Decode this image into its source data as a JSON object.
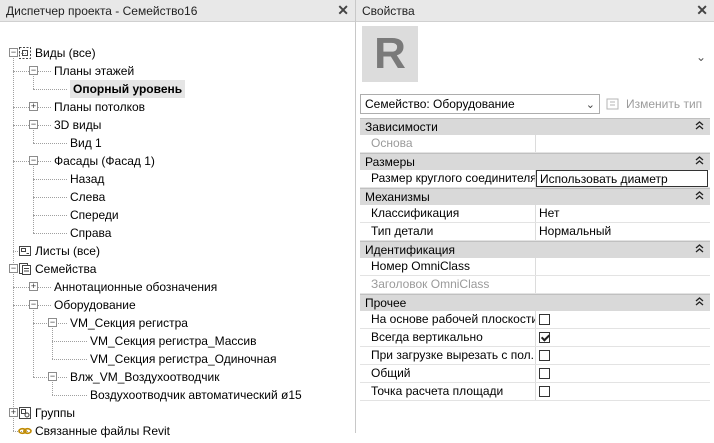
{
  "project_browser": {
    "title": "Диспетчер проекта - Семейство16",
    "nodes": [
      {
        "label": "Виды (все)",
        "level": 0,
        "exp": "-",
        "icon": "views"
      },
      {
        "label": "Планы этажей",
        "level": 1,
        "exp": "-"
      },
      {
        "label": "Опорный уровень",
        "level": 2,
        "selected": true
      },
      {
        "label": "Планы потолков",
        "level": 1,
        "exp": "+"
      },
      {
        "label": "3D виды",
        "level": 1,
        "exp": "-"
      },
      {
        "label": "Вид 1",
        "level": 2
      },
      {
        "label": "Фасады (Фасад 1)",
        "level": 1,
        "exp": "-"
      },
      {
        "label": "Назад",
        "level": 2
      },
      {
        "label": "Слева",
        "level": 2
      },
      {
        "label": "Спереди",
        "level": 2
      },
      {
        "label": "Справа",
        "level": 2
      },
      {
        "label": "Листы (все)",
        "level": 0,
        "icon": "sheets"
      },
      {
        "label": "Семейства",
        "level": 0,
        "exp": "-",
        "icon": "families"
      },
      {
        "label": "Аннотационные обозначения",
        "level": 1,
        "exp": "+"
      },
      {
        "label": "Оборудование",
        "level": 1,
        "exp": "-"
      },
      {
        "label": "VM_Секция регистра",
        "level": 2,
        "exp": "-"
      },
      {
        "label": "VM_Секция регистра_Массив",
        "level": 3
      },
      {
        "label": "VM_Секция регистра_Одиночная",
        "level": 3
      },
      {
        "label": "Влж_VM_Воздухоотводчик",
        "level": 2,
        "exp": "-"
      },
      {
        "label": "Воздухоотводчик автоматический ø15",
        "level": 3
      },
      {
        "label": "Группы",
        "level": 0,
        "exp": "+",
        "icon": "groups"
      },
      {
        "label": "Связанные файлы Revit",
        "level": 0,
        "icon": "links"
      }
    ]
  },
  "properties": {
    "title": "Свойства",
    "logo_letter": "R",
    "type_selector": "Семейство: Оборудование",
    "edit_type": "Изменить тип",
    "groups": [
      {
        "name": "Зависимости",
        "rows": [
          {
            "name": "Основа",
            "value": "",
            "disabled": true
          }
        ]
      },
      {
        "name": "Размеры",
        "rows": [
          {
            "name": "Размер круглого соединителя",
            "value": "Использовать диаметр",
            "active": true
          }
        ]
      },
      {
        "name": "Механизмы",
        "rows": [
          {
            "name": "Классификация",
            "value": "Нет"
          },
          {
            "name": "Тип детали",
            "value": "Нормальный"
          }
        ]
      },
      {
        "name": "Идентификация",
        "rows": [
          {
            "name": "Номер OmniClass",
            "value": ""
          },
          {
            "name": "Заголовок OmniClass",
            "value": "",
            "disabled": true
          }
        ]
      },
      {
        "name": "Прочее",
        "rows": [
          {
            "name": "На основе рабочей плоскости",
            "checkbox": false
          },
          {
            "name": "Всегда вертикально",
            "checkbox": true
          },
          {
            "name": "При загрузке вырезать с пол...",
            "checkbox": false
          },
          {
            "name": "Общий",
            "checkbox": false
          },
          {
            "name": "Точка расчета площади",
            "checkbox": false
          }
        ]
      }
    ]
  }
}
